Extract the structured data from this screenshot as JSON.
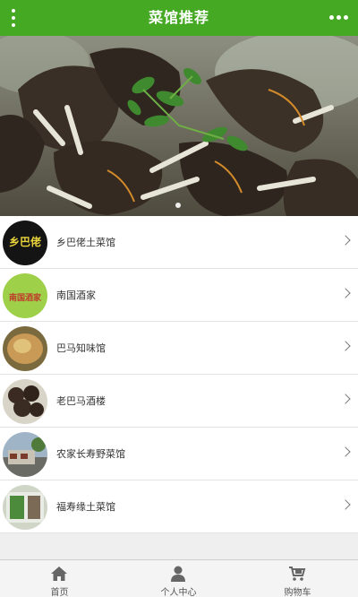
{
  "header": {
    "title": "菜馆推荐",
    "menu_icon": "vertical-dots-icon",
    "more_icon": "horizontal-dots-icon",
    "bg_color": "#45a923"
  },
  "banner": {
    "image": "braised-meat-dish-photo",
    "slide_indicator": "1"
  },
  "restaurants": [
    {
      "name": "乡巴佬土菜馆",
      "thumb_text": "乡巴佬"
    },
    {
      "name": "南国酒家",
      "thumb_text": "南国酒家"
    },
    {
      "name": "巴马知味馆"
    },
    {
      "name": "老巴马酒楼"
    },
    {
      "name": "农家长寿野菜馆"
    },
    {
      "name": "福寿缘土菜馆"
    }
  ],
  "tabbar": {
    "items": [
      {
        "label": "首页",
        "icon": "home-icon"
      },
      {
        "label": "个人中心",
        "icon": "user-icon"
      },
      {
        "label": "购物车",
        "icon": "cart-icon"
      }
    ]
  }
}
